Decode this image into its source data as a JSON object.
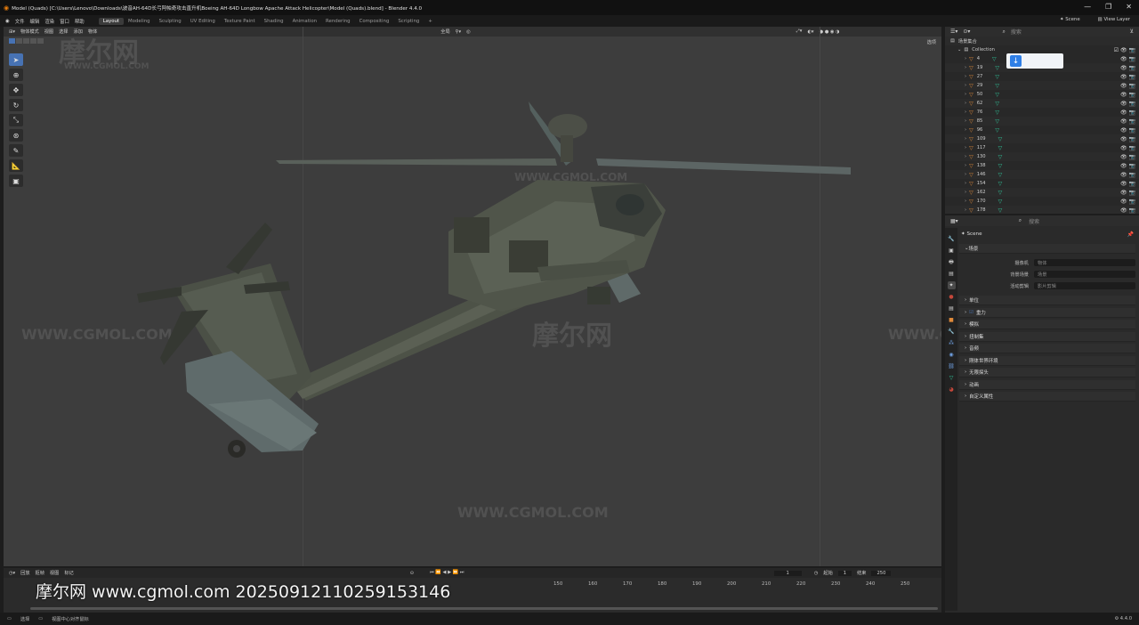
{
  "window": {
    "title": "Model (Quads) [C:\\Users\\Lenovo\\Downloads\\波音AH-64D长弓阿帕奇攻击直升机Boeing AH-64D Longbow Apache Attack Helicopter\\Model (Quads).blend] - Blender 4.4.0",
    "controls": [
      "—",
      "❐",
      "✕"
    ]
  },
  "menu": {
    "items": [
      "文件",
      "编辑",
      "渲染",
      "窗口",
      "帮助"
    ],
    "workspaces": [
      "Layout",
      "Modeling",
      "Sculpting",
      "UV Editing",
      "Texture Paint",
      "Shading",
      "Animation",
      "Rendering",
      "Compositing",
      "Scripting",
      "+"
    ],
    "active_workspace": "Layout",
    "scene_label": "Scene",
    "view_layer_label": "View Layer"
  },
  "viewport": {
    "mode": "物体模式",
    "menu": [
      "视图",
      "选择",
      "添加",
      "物体"
    ],
    "transform": "全局",
    "options_label": "选项"
  },
  "watermarks": {
    "logo": "摩尔网",
    "url": "WWW.CGMOL.COM"
  },
  "overlay_text": "摩尔网 www.cgmol.com 20250912110259153146",
  "outliner": {
    "search_placeholder": "搜索",
    "root": "场景集合",
    "collection": "Collection",
    "items": [
      "4",
      "19",
      "27",
      "29",
      "50",
      "62",
      "76",
      "85",
      "96",
      "109",
      "117",
      "130",
      "138",
      "146",
      "154",
      "162",
      "170",
      "178"
    ]
  },
  "properties": {
    "search_placeholder": "搜索",
    "context": "Scene",
    "scene_section": "场景",
    "fields": [
      {
        "label": "摄像机",
        "value": "物体"
      },
      {
        "label": "背景场景",
        "value": "场景"
      },
      {
        "label": "活动剪辑",
        "value": "影片剪辑"
      }
    ],
    "sections": [
      "单位",
      "重力",
      "模拟",
      "扭制集",
      "音频",
      "刚体世界环境",
      "无限探头",
      "动画",
      "自定义属性"
    ]
  },
  "timeline": {
    "menu": [
      "回放",
      "抠帧",
      "视图",
      "标记"
    ],
    "current_frame": "1",
    "start_label": "起始",
    "start": "1",
    "end_label": "结束",
    "end": "250",
    "ruler": [
      "150",
      "160",
      "170",
      "180",
      "190",
      "200",
      "210",
      "220",
      "230",
      "240",
      "250"
    ]
  },
  "status": {
    "left": [
      "选择",
      "视图中心对齐鼠标"
    ],
    "version": "4.4.0"
  },
  "colors": {
    "accent": "#4772b3",
    "object_orange": "#e08a3a",
    "modifier_green": "#2fc69b",
    "viewport_bg": "#3d3d3d"
  }
}
